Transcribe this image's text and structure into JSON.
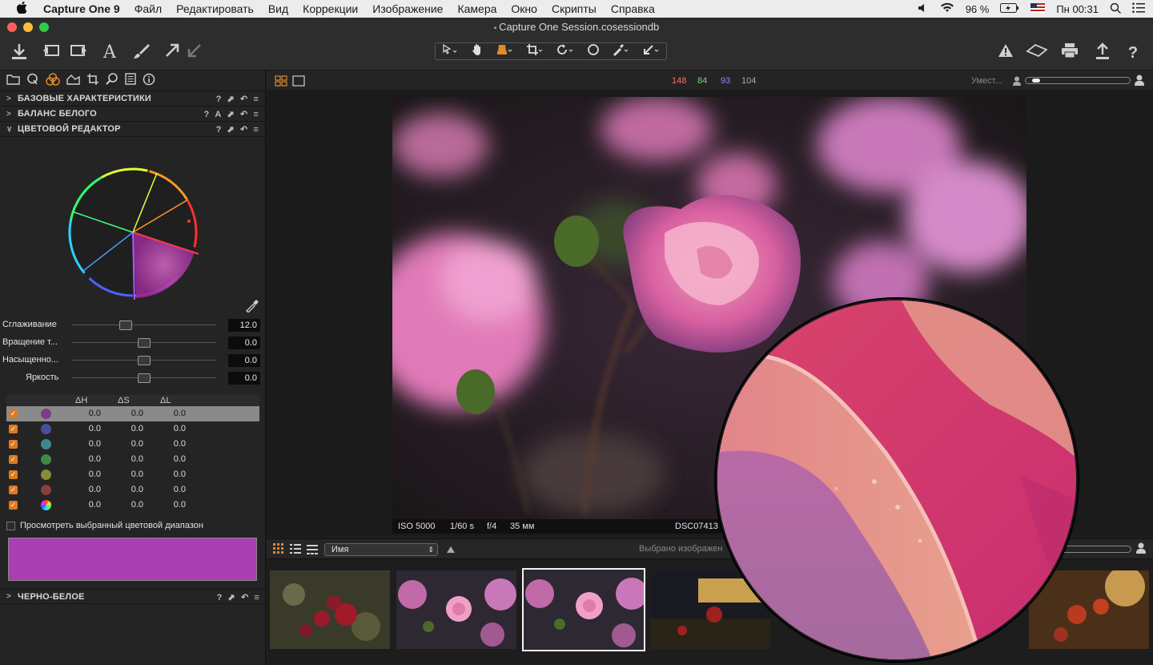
{
  "menubar": {
    "apple": "",
    "app_name": "Capture One 9",
    "items": [
      "Файл",
      "Редактировать",
      "Вид",
      "Коррекции",
      "Изображение",
      "Камера",
      "Окно",
      "Скрипты",
      "Справка"
    ],
    "battery": "96 %",
    "clock": "Пн 00:31"
  },
  "window": {
    "title": "Capture One Session.cosessiondb"
  },
  "viewer": {
    "rgb": {
      "r": "148",
      "g": "84",
      "b": "93",
      "l": "104"
    },
    "zoom_label": "Умест...",
    "meta": {
      "iso": "ISO 5000",
      "shutter": "1/60 s",
      "aperture": "f/4",
      "focal": "35 мм",
      "filename": "DSC07413"
    }
  },
  "panels": {
    "basic": "БАЗОВЫЕ ХАРАКТЕРИСТИКИ",
    "wb": "БАЛАНС БЕЛОГО",
    "color_editor": "ЦВЕТОВОЙ РЕДАКТОР",
    "bw": "ЧЕРНО-БЕЛОЕ",
    "hdr_q": "?",
    "hdr_a": "A"
  },
  "sliders": [
    {
      "label": "Сглаживание",
      "value": "12.0",
      "pos": 0.37
    },
    {
      "label": "Вращение т...",
      "value": "0.0",
      "pos": 0.5
    },
    {
      "label": "Насыщенно...",
      "value": "0.0",
      "pos": 0.5
    },
    {
      "label": "Яркость",
      "value": "0.0",
      "pos": 0.5
    }
  ],
  "color_table": {
    "headers": [
      "ΔH",
      "ΔS",
      "ΔL"
    ],
    "rows": [
      {
        "color": "#7b3c8a",
        "dh": "0.0",
        "ds": "0.0",
        "dl": "0.0",
        "selected": true
      },
      {
        "color": "#4a4f9a",
        "dh": "0.0",
        "ds": "0.0",
        "dl": "0.0"
      },
      {
        "color": "#3d8790",
        "dh": "0.0",
        "ds": "0.0",
        "dl": "0.0"
      },
      {
        "color": "#3f8a4a",
        "dh": "0.0",
        "ds": "0.0",
        "dl": "0.0"
      },
      {
        "color": "#8a8a3c",
        "dh": "0.0",
        "ds": "0.0",
        "dl": "0.0"
      },
      {
        "color": "#8a3f3f",
        "dh": "0.0",
        "ds": "0.0",
        "dl": "0.0"
      },
      {
        "color": "rainbow",
        "dh": "0.0",
        "ds": "0.0",
        "dl": "0.0"
      }
    ]
  },
  "view_selected_label": "Просмотреть выбранный цветовой диапазон",
  "selected_color": "#a93fb2",
  "browser": {
    "sort_by": "Имя",
    "selected_text": "Выбрано изображен"
  }
}
